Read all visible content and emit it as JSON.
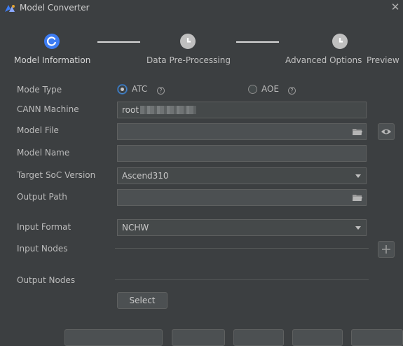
{
  "window": {
    "title": "Model Converter",
    "close_glyph": "✕"
  },
  "steps": [
    {
      "label": "Model Information",
      "state": "active"
    },
    {
      "label": "Data Pre-Processing",
      "state": "pending"
    },
    {
      "label": "Advanced Options",
      "state": "pending"
    },
    {
      "label": "Preview",
      "state": "pending"
    }
  ],
  "form": {
    "mode_type": {
      "label": "Mode Type",
      "options": [
        {
          "label": "ATC",
          "selected": true
        },
        {
          "label": "AOE",
          "selected": false
        }
      ],
      "help_glyph": "?"
    },
    "cann_machine": {
      "label": "CANN Machine",
      "value": "root"
    },
    "model_file": {
      "label": "Model File",
      "value": ""
    },
    "model_name": {
      "label": "Model Name",
      "value": ""
    },
    "target_soc": {
      "label": "Target SoC Version",
      "value": "Ascend310"
    },
    "output_path": {
      "label": "Output Path",
      "value": ""
    },
    "input_format": {
      "label": "Input Format",
      "value": "NCHW"
    },
    "input_nodes": {
      "label": "Input Nodes"
    },
    "output_nodes": {
      "label": "Output Nodes"
    },
    "select_button": "Select"
  },
  "colors": {
    "accent": "#3d7cf2",
    "background": "#3c3f41"
  }
}
